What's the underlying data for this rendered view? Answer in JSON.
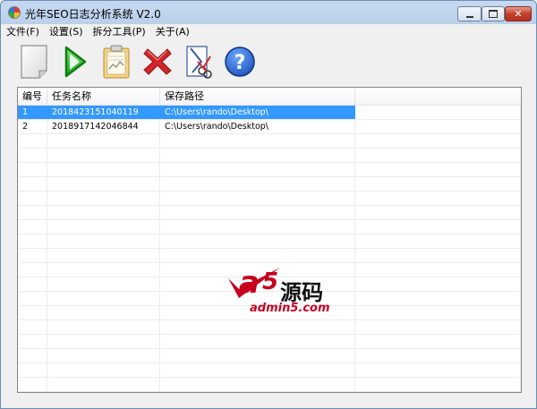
{
  "window": {
    "title": "光年SEO日志分析系统 V2.0",
    "controls": {
      "minimize": "minimize",
      "maximize": "maximize",
      "close": "close"
    }
  },
  "menu": [
    {
      "label": "文件(F)"
    },
    {
      "label": "设置(S)"
    },
    {
      "label": "拆分工具(P)"
    },
    {
      "label": "关于(A)"
    }
  ],
  "toolbar": {
    "buttons": [
      {
        "icon": "new-document-icon"
      },
      {
        "icon": "play-icon"
      },
      {
        "icon": "clipboard-chart-icon"
      },
      {
        "icon": "delete-x-icon"
      },
      {
        "icon": "split-cut-icon"
      },
      {
        "icon": "help-icon"
      }
    ]
  },
  "table": {
    "headers": [
      "编号",
      "任务名称",
      "保存路径",
      ""
    ],
    "rows": [
      {
        "id": "1",
        "name": "2018423151040119",
        "path": "C:\\Users\\rando\\Desktop\\",
        "selected": true
      },
      {
        "id": "2",
        "name": "2018917142046844",
        "path": "C:\\Users\\rando\\Desktop\\",
        "selected": false
      }
    ]
  },
  "watermark": {
    "logo": "a5",
    "brand_cn": "源码",
    "url": "admin5.com"
  },
  "colors": {
    "selection": "#3399ff",
    "title_bar": "#c6d9f0",
    "watermark_red": "#c8001e"
  }
}
